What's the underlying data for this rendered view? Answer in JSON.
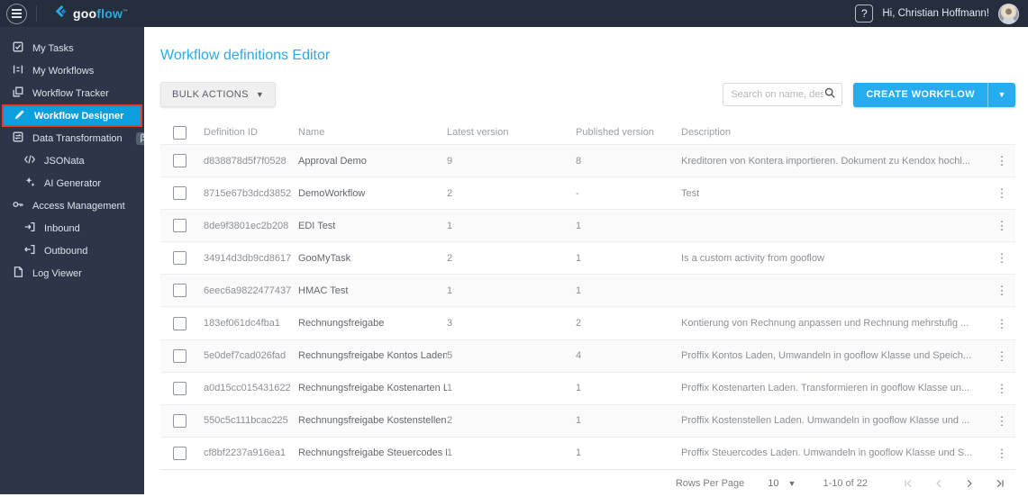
{
  "colors": {
    "topbar_bg": "#242e3d",
    "sidebar_bg": "#2c3648",
    "accent_cyan": "#29abe2",
    "button_blue": "#25adef",
    "active_item_bg": "#0d9edd",
    "annotation_red": "#e8392b"
  },
  "topbar": {
    "logo_goo": "goo",
    "logo_flow": "flow",
    "logo_tm": "™",
    "help_label": "?",
    "greeting": "Hi, Christian Hoffmann!"
  },
  "sidebar": {
    "beta_badge": "β",
    "items": [
      {
        "label": "My Tasks",
        "icon": "tasks-icon"
      },
      {
        "label": "My Workflows",
        "icon": "workflows-icon"
      },
      {
        "label": "Workflow Tracker",
        "icon": "tracker-icon"
      },
      {
        "label": "Workflow Designer",
        "icon": "pen-icon",
        "active": true
      },
      {
        "label": "Data Transformation",
        "icon": "transform-icon",
        "badge": "β"
      },
      {
        "label": "JSONata",
        "icon": "code-icon",
        "indent": true
      },
      {
        "label": "AI Generator",
        "icon": "sparkle-icon",
        "indent": true
      },
      {
        "label": "Access Management",
        "icon": "key-icon"
      },
      {
        "label": "Inbound",
        "icon": "inbound-icon",
        "indent": true
      },
      {
        "label": "Outbound",
        "icon": "outbound-icon",
        "indent": true
      },
      {
        "label": "Log Viewer",
        "icon": "document-icon"
      }
    ]
  },
  "main": {
    "title": "Workflow definitions Editor",
    "toolbar": {
      "bulk_actions_label": "BULK ACTIONS",
      "search_placeholder": "Search on name, description",
      "create_workflow_label": "CREATE WORKFLOW"
    },
    "table": {
      "columns": [
        "Definition ID",
        "Name",
        "Latest version",
        "Published version",
        "Description"
      ],
      "rows": [
        {
          "id": "d838878d5f7f0528",
          "name": "Approval Demo",
          "latest": "9",
          "published": "8",
          "description": "Kreditoren von Kontera importieren. Dokument zu Kendox hochl..."
        },
        {
          "id": "8715e67b3dcd3852",
          "name": "DemoWorkflow",
          "latest": "2",
          "published": "-",
          "description": "Test"
        },
        {
          "id": "8de9f3801ec2b208",
          "name": "EDI Test",
          "latest": "1",
          "published": "1",
          "description": ""
        },
        {
          "id": "34914d3db9cd8617",
          "name": "GooMyTask",
          "latest": "2",
          "published": "1",
          "description": "Is a custom activity from gooflow"
        },
        {
          "id": "6eec6a9822477437",
          "name": "HMAC Test",
          "latest": "1",
          "published": "1",
          "description": ""
        },
        {
          "id": "183ef061dc4fba1",
          "name": "Rechnungsfreigabe",
          "latest": "3",
          "published": "2",
          "description": "Kontierung von Rechnung anpassen und Rechnung mehrstufig ..."
        },
        {
          "id": "5e0def7cad026fad",
          "name": "Rechnungsfreigabe Kontos Laden",
          "latest": "5",
          "published": "4",
          "description": "Proffix Kontos Laden, Umwandeln in gooflow Klasse und Speich..."
        },
        {
          "id": "a0d15cc015431622",
          "name": "Rechnungsfreigabe Kostenarten Laden",
          "latest": "1",
          "published": "1",
          "description": "Proffix Kostenarten Laden. Transformieren in gooflow Klasse un..."
        },
        {
          "id": "550c5c111bcac225",
          "name": "Rechnungsfreigabe Kostenstellen Laden",
          "latest": "2",
          "published": "1",
          "description": "Proffix Kostenstellen Laden. Umwandeln in gooflow Klasse und ..."
        },
        {
          "id": "cf8bf2237a916ea1",
          "name": "Rechnungsfreigabe Steuercodes Laden",
          "latest": "1",
          "published": "1",
          "description": "Proffix Steuercodes Laden. Umwandeln in gooflow Klasse und S..."
        }
      ]
    },
    "pagination": {
      "rows_per_page_label": "Rows Per Page",
      "rows_per_page_value": "10",
      "range": "1-10 of 22"
    }
  }
}
